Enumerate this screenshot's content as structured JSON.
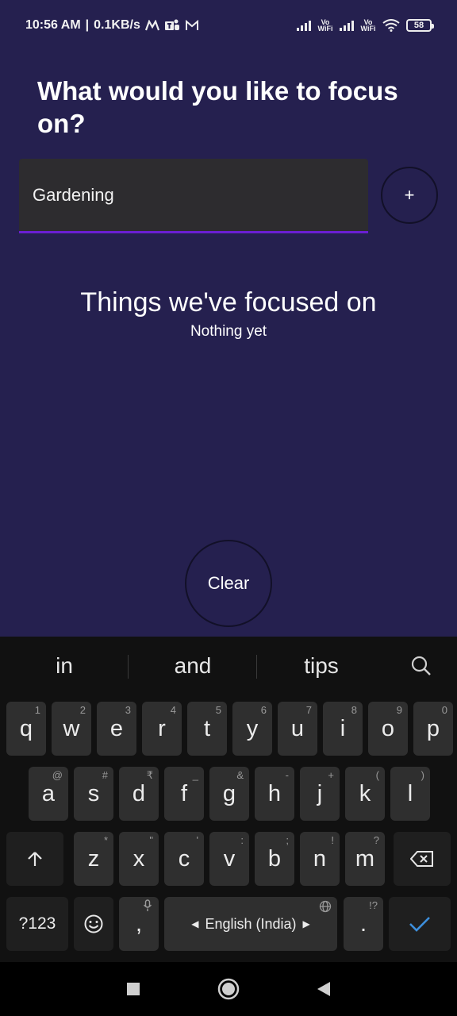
{
  "status_bar": {
    "time": "10:56 AM",
    "network_speed": "0.1KB/s",
    "vowifi_1": "Vo WiFi",
    "vowifi_2": "Vo WiFi",
    "battery": "58"
  },
  "app": {
    "heading": "What would you like to focus on?",
    "input_value": "Gardening",
    "add_label": "+",
    "section_title": "Things we've focused on",
    "section_empty": "Nothing yet",
    "clear_label": "Clear"
  },
  "keyboard": {
    "suggestions": [
      "in",
      "and",
      "tips"
    ],
    "row1": [
      {
        "k": "q",
        "h": "1"
      },
      {
        "k": "w",
        "h": "2"
      },
      {
        "k": "e",
        "h": "3"
      },
      {
        "k": "r",
        "h": "4"
      },
      {
        "k": "t",
        "h": "5"
      },
      {
        "k": "y",
        "h": "6"
      },
      {
        "k": "u",
        "h": "7"
      },
      {
        "k": "i",
        "h": "8"
      },
      {
        "k": "o",
        "h": "9"
      },
      {
        "k": "p",
        "h": "0"
      }
    ],
    "row2": [
      {
        "k": "a",
        "h": "@"
      },
      {
        "k": "s",
        "h": "#"
      },
      {
        "k": "d",
        "h": "₹"
      },
      {
        "k": "f",
        "h": "_"
      },
      {
        "k": "g",
        "h": "&"
      },
      {
        "k": "h",
        "h": "-"
      },
      {
        "k": "j",
        "h": "+"
      },
      {
        "k": "k",
        "h": "("
      },
      {
        "k": "l",
        "h": ")"
      }
    ],
    "row3": [
      {
        "k": "z",
        "h": "*"
      },
      {
        "k": "x",
        "h": "\""
      },
      {
        "k": "c",
        "h": "'"
      },
      {
        "k": "v",
        "h": ":"
      },
      {
        "k": "b",
        "h": ";"
      },
      {
        "k": "n",
        "h": "!"
      },
      {
        "k": "m",
        "h": "?"
      }
    ],
    "symbols_key": "?123",
    "comma_key": ",",
    "space_label": "English (India)",
    "period_key": ".",
    "period_hint": "!?"
  },
  "colors": {
    "background": "#25204f",
    "accent": "#6a1fd2",
    "enter_check": "#3d8fdc"
  }
}
